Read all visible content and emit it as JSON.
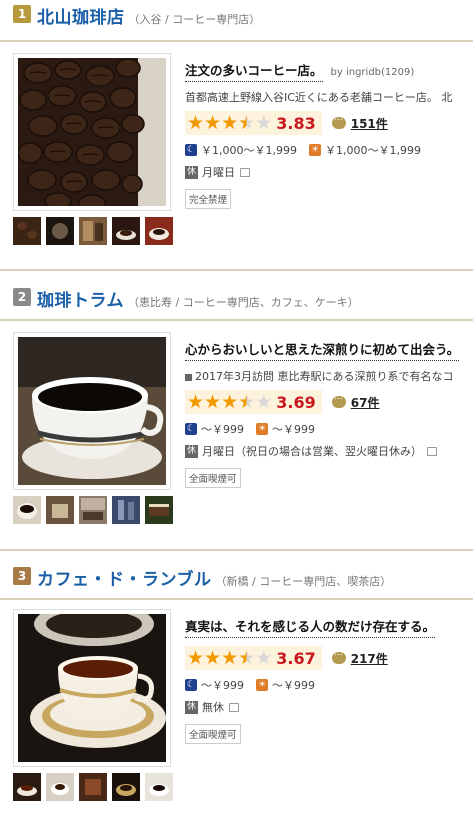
{
  "items": [
    {
      "rank": "1",
      "name": "北山珈琲店",
      "area": "（入谷 / コーヒー専門店）",
      "catch": "注文の多いコーヒー店。",
      "byline": "by ingridb(1209)",
      "desc": "首都高速上野線入谷IC近くにある老舗コーヒー店。 北",
      "rating": 3.83,
      "score": "3.83",
      "review_count": "151件",
      "dinner_price": "￥1,000～￥1,999",
      "lunch_price": "￥1,000～￥1,999",
      "holiday": "月曜日",
      "smoking": "完全禁煙"
    },
    {
      "rank": "2",
      "name": "珈琲トラム",
      "area": "（恵比寿 / コーヒー専門店、カフェ、ケーキ）",
      "catch": "心からおいしいと思えた深煎りに初めて出会う。",
      "byline": "",
      "desc": "2017年3月訪問 恵比寿駅にある深煎り系で有名なコ",
      "rating": 3.69,
      "score": "3.69",
      "review_count": "67件",
      "dinner_price": "～￥999",
      "lunch_price": "～￥999",
      "holiday": "月曜日（祝日の場合は営業、翌火曜日休み）",
      "smoking": "全面喫煙可"
    },
    {
      "rank": "3",
      "name": "カフェ・ド・ランブル",
      "area": "（新橋 / コーヒー専門店、喫茶店）",
      "catch": "真実は、それを感じる人の数だけ存在する。",
      "byline": "",
      "desc": "",
      "rating": 3.67,
      "score": "3.67",
      "review_count": "217件",
      "dinner_price": "～￥999",
      "lunch_price": "～￥999",
      "holiday": "無休",
      "smoking": "全面喫煙可"
    }
  ],
  "icons": {
    "dinner": "moon-icon",
    "lunch": "sun-icon",
    "holiday": "休",
    "review": "speech-bubble-icon"
  },
  "colors": {
    "shop_name": "#1a5fa8",
    "score": "#c9171e",
    "star": "#f39800",
    "rating_bg": "#fdf3dc"
  }
}
